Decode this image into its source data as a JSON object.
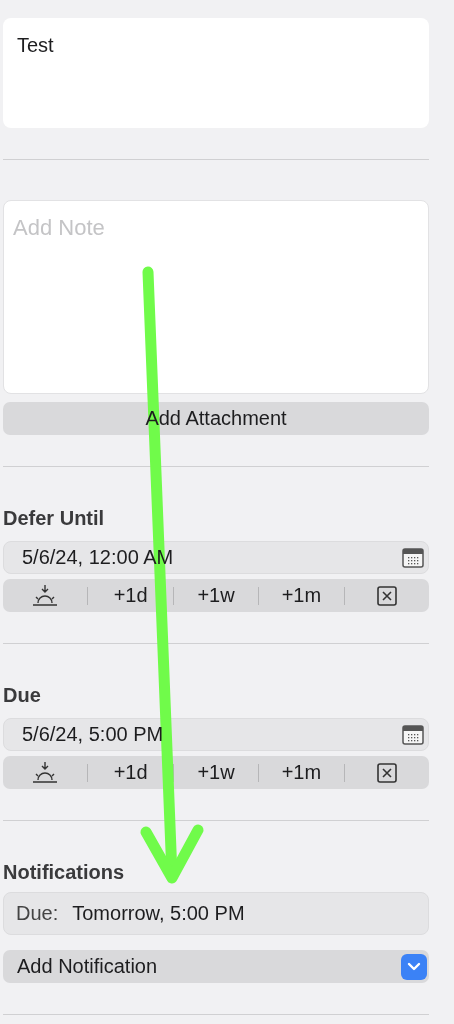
{
  "title_field": {
    "value": "Test"
  },
  "note_field": {
    "placeholder": "Add Note"
  },
  "attachment_button": {
    "label": "Add Attachment"
  },
  "sections": [
    {
      "heading": "Defer Until",
      "date_field": {
        "value": "5/6/24, 12:00 AM"
      },
      "quick_buttons": [
        {
          "kind": "today"
        },
        {
          "kind": "text",
          "label": "+1d"
        },
        {
          "kind": "text",
          "label": "+1w"
        },
        {
          "kind": "text",
          "label": "+1m"
        },
        {
          "kind": "clear"
        }
      ]
    },
    {
      "heading": "Due",
      "date_field": {
        "value": "5/6/24, 5:00 PM"
      },
      "quick_buttons": [
        {
          "kind": "today"
        },
        {
          "kind": "text",
          "label": "+1d"
        },
        {
          "kind": "text",
          "label": "+1w"
        },
        {
          "kind": "text",
          "label": "+1m"
        },
        {
          "kind": "clear"
        }
      ]
    }
  ],
  "notifications": {
    "heading": "Notifications",
    "items": [
      {
        "label": "Due:",
        "value": "Tomorrow, 5:00 PM"
      }
    ],
    "add_button": {
      "label": "Add Notification"
    }
  },
  "annotation": {
    "kind": "arrow"
  }
}
